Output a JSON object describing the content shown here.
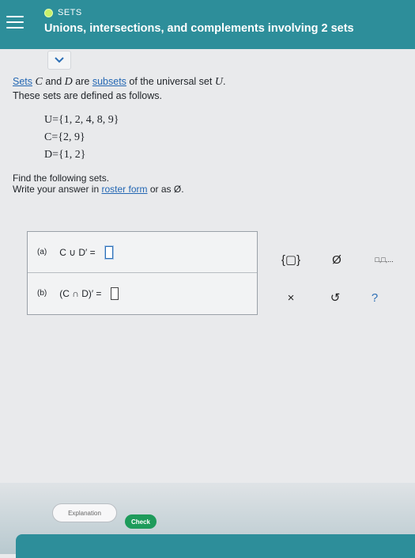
{
  "header": {
    "topic_label": "SETS",
    "title": "Unions, intersections, and complements involving 2 sets"
  },
  "content": {
    "line1": {
      "word1": "Sets",
      "sym1": "C",
      "and": "and",
      "sym2": "D",
      "are": "are",
      "link2": "subsets",
      "rest": "of the universal set",
      "sym3": "U",
      "period": "."
    },
    "line2": "These sets are defined as follows.",
    "sets": [
      {
        "name": "U",
        "text": "U={1, 2, 4, 8, 9}"
      },
      {
        "name": "C",
        "text": "C={2, 9}"
      },
      {
        "name": "D",
        "text": "D={1, 2}"
      }
    ],
    "instructions_line1": "Find the following sets.",
    "instructions_line2_start": "Write your answer in",
    "instructions_link": "roster form",
    "instructions_line2_end": "or as Ø."
  },
  "answers": [
    {
      "part": "(a)",
      "expr": "C ∪ D′ ="
    },
    {
      "part": "(b)",
      "expr": "(C ∩ D)′ ="
    }
  ],
  "tools": {
    "braces": "{▢}",
    "emptyset": "Ø",
    "dots": "□,□,...",
    "close": "×",
    "undo": "↺",
    "help": "?"
  },
  "buttons": {
    "explanation": "Explanation",
    "check": "Check"
  }
}
